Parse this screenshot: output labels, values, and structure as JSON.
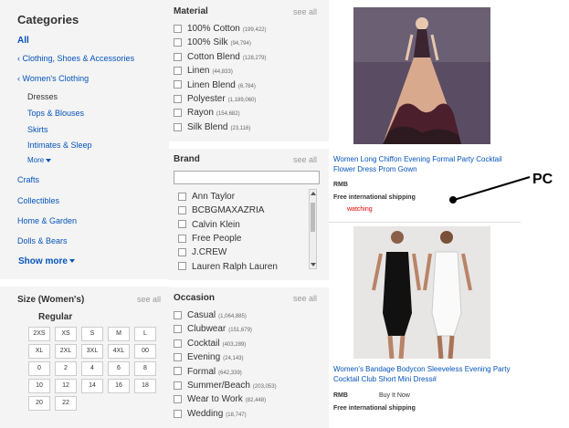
{
  "categories": {
    "title": "Categories",
    "all": "All",
    "parent1": "Clothing, Shoes & Accessories",
    "parent2": "Women's Clothing",
    "current": "Dresses",
    "subs": [
      "Tops & Blouses",
      "Skirts",
      "Intimates & Sleep"
    ],
    "more": "More",
    "other": [
      "Crafts",
      "Collectibles",
      "Home & Garden",
      "Dolls & Bears"
    ],
    "show_more": "Show more"
  },
  "size": {
    "title": "Size (Women's)",
    "see_all": "see all",
    "group": "Regular",
    "values": [
      "2XS",
      "XS",
      "S",
      "M",
      "L",
      "XL",
      "2XL",
      "3XL",
      "4XL",
      "00",
      "0",
      "2",
      "4",
      "6",
      "8",
      "10",
      "12",
      "14",
      "16",
      "18",
      "20",
      "22"
    ]
  },
  "material": {
    "title": "Material",
    "see_all": "see all",
    "options": [
      {
        "label": "100% Cotton",
        "count": "(199,422)"
      },
      {
        "label": "100% Silk",
        "count": "(94,794)"
      },
      {
        "label": "Cotton Blend",
        "count": "(128,279)"
      },
      {
        "label": "Linen",
        "count": "(44,833)"
      },
      {
        "label": "Linen Blend",
        "count": "(6,784)"
      },
      {
        "label": "Polyester",
        "count": "(1,189,060)"
      },
      {
        "label": "Rayon",
        "count": "(154,682)"
      },
      {
        "label": "Silk Blend",
        "count": "(23,116)"
      }
    ]
  },
  "brand": {
    "title": "Brand",
    "see_all": "see all",
    "options": [
      "Ann Taylor",
      "BCBGMAXAZRIA",
      "Calvin Klein",
      "Free People",
      "J.CREW",
      "Lauren Ralph Lauren"
    ]
  },
  "occasion": {
    "title": "Occasion",
    "see_all": "see all",
    "options": [
      {
        "label": "Casual",
        "count": "(1,064,885)"
      },
      {
        "label": "Clubwear",
        "count": "(151,679)"
      },
      {
        "label": "Cocktail",
        "count": "(403,289)"
      },
      {
        "label": "Evening",
        "count": "(24,143)"
      },
      {
        "label": "Formal",
        "count": "(642,339)"
      },
      {
        "label": "Summer/Beach",
        "count": "(203,053)"
      },
      {
        "label": "Wear to Work",
        "count": "(82,448)"
      },
      {
        "label": "Wedding",
        "count": "(18,747)"
      }
    ]
  },
  "products": [
    {
      "title": "Women Long Chiffon Evening Formal Party Cocktail Flower Dress Prom Gown",
      "currency": "RMB",
      "shipping": "Free international shipping",
      "status": "watching"
    },
    {
      "title": "Women's Bandage Bodycon Sleeveless Evening Party Cocktail Club Short Mini Dress#",
      "currency": "RMB",
      "buy": "Buy It Now",
      "shipping": "Free international shipping"
    }
  ],
  "annotation": "PC",
  "colors": {
    "link": "#0654ba",
    "panel": "#f4f4f4",
    "watch": "#dd0000"
  }
}
